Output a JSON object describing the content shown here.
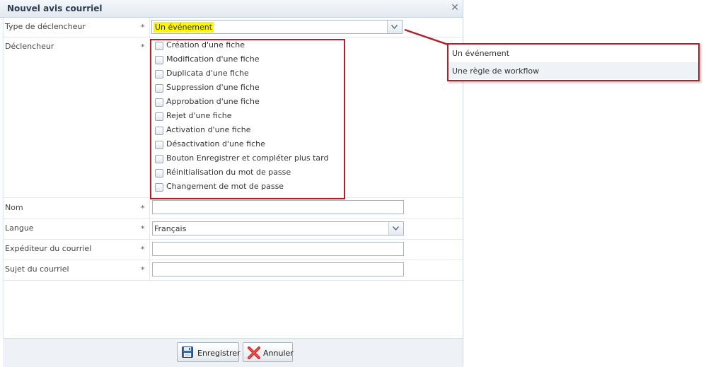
{
  "dialog": {
    "title": "Nouvel avis courriel",
    "close_icon": "close-icon"
  },
  "form": {
    "trigger_type": {
      "label": "Type de déclencheur",
      "required": "*",
      "value": "Un événement"
    },
    "trigger": {
      "label": "Déclencheur",
      "required": "*",
      "options": [
        "Création d'une fiche",
        "Modification d'une fiche",
        "Duplicata d'une fiche",
        "Suppression d'une fiche",
        "Approbation d'une fiche",
        "Rejet d'une fiche",
        "Activation d'une fiche",
        "Désactivation d'une fiche",
        "Bouton Enregistrer et compléter plus tard",
        "Réinitialisation du mot de passe",
        "Changement de mot de passe"
      ]
    },
    "name": {
      "label": "Nom",
      "required": "*",
      "value": ""
    },
    "language": {
      "label": "Langue",
      "required": "*",
      "value": "Français"
    },
    "sender": {
      "label": "Expéditeur du courriel",
      "required": "*",
      "value": ""
    },
    "subject": {
      "label": "Sujet du courriel",
      "required": "*",
      "value": ""
    }
  },
  "dropdown": {
    "items": [
      "Un événement",
      "Une règle de workflow"
    ]
  },
  "footer": {
    "save_label": "Enregistrer",
    "cancel_label": "Annuler"
  },
  "colors": {
    "annotation_red": "#b0202a",
    "highlight_yellow": "#fff700"
  }
}
